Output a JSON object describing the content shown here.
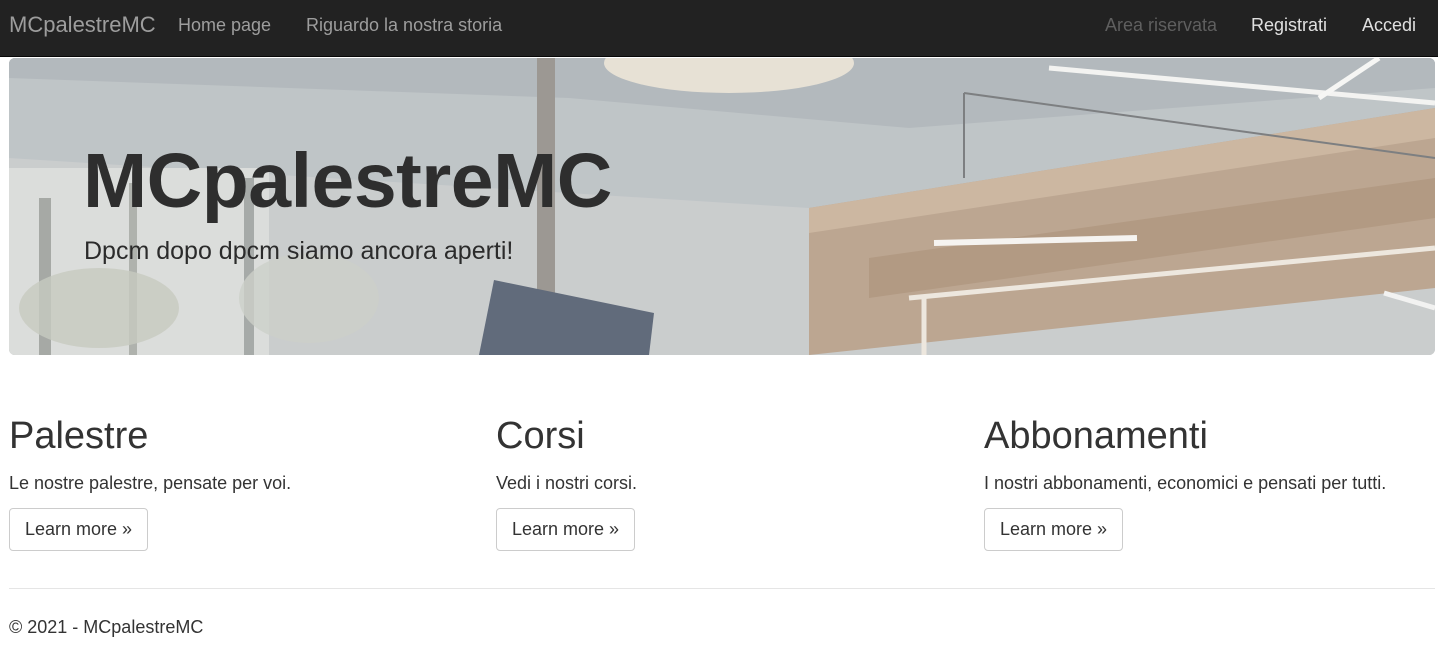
{
  "navbar": {
    "brand": "MCpalestreMC",
    "left_links": [
      {
        "label": "Home page"
      },
      {
        "label": "Riguardo la nostra storia"
      }
    ],
    "right_links": [
      {
        "label": "Area riservata"
      },
      {
        "label": "Registrati"
      },
      {
        "label": "Accedi"
      }
    ]
  },
  "hero": {
    "title": "MCpalestreMC",
    "subtitle": "Dpcm dopo dpcm siamo ancora aperti!"
  },
  "features": [
    {
      "title": "Palestre",
      "text": "Le nostre palestre, pensate per voi.",
      "button": "Learn more »"
    },
    {
      "title": "Corsi",
      "text": "Vedi i nostri corsi.",
      "button": "Learn more »"
    },
    {
      "title": "Abbonamenti",
      "text": "I nostri abbonamenti, economici e pensati per tutti.",
      "button": "Learn more »"
    }
  ],
  "footer": {
    "text": "© 2021 - MCpalestreMC"
  },
  "colors": {
    "navbar_bg": "#222222",
    "nav_text": "#9d9d9d",
    "nav_text_active": "#e0e0e0",
    "nav_text_disabled": "#5f5f5f",
    "body_text": "#333333"
  }
}
